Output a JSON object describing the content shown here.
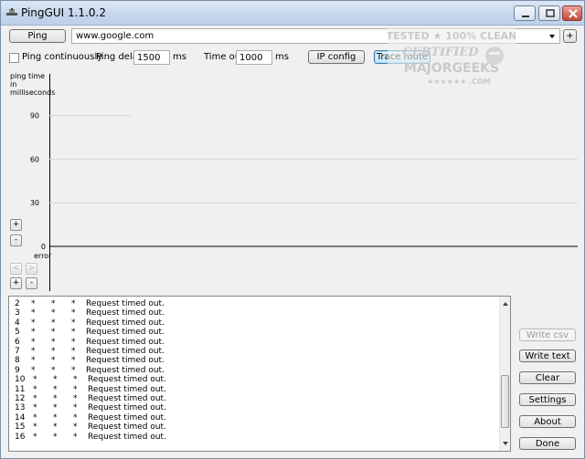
{
  "window": {
    "title": "PingGUI 1.1.0.2"
  },
  "toolbar": {
    "ping_label": "Ping",
    "host_value": "www.google.com",
    "add_label": "+",
    "ping_continuously_label": "Ping continuously",
    "ping_continuously_checked": false,
    "ping_delay_label": "Ping delay",
    "ping_delay_value": "1500",
    "ping_delay_unit": "ms",
    "timeout_label": "Time out",
    "timeout_value": "1000",
    "timeout_unit": "ms",
    "ip_config_label": "IP config",
    "trace_route_label": "Trace route"
  },
  "watermark": {
    "line1": "TESTED ★ 100% CLEAN",
    "line2": "CERTIFIED",
    "line3": "MAJORGEEKS",
    "line4": "★★★★★★ .COM"
  },
  "chart_data": {
    "type": "line",
    "ylabel": "ping time in milliseconds",
    "yticks": [
      90,
      60,
      30,
      0
    ],
    "ylim": [
      0,
      100
    ],
    "error_label": "error",
    "series": [],
    "grid": true
  },
  "chart_controls": {
    "zoom_in_label": "+",
    "zoom_out_label": "-",
    "scroll_left_label": "<",
    "scroll_right_label": ">",
    "x_zoom_in_label": "+",
    "x_zoom_out_label": "-"
  },
  "log": {
    "rows": [
      {
        "n": "2",
        "a": "*",
        "b": "*",
        "c": "*",
        "msg": "Request timed out."
      },
      {
        "n": "3",
        "a": "*",
        "b": "*",
        "c": "*",
        "msg": "Request timed out."
      },
      {
        "n": "4",
        "a": "*",
        "b": "*",
        "c": "*",
        "msg": "Request timed out."
      },
      {
        "n": "5",
        "a": "*",
        "b": "*",
        "c": "*",
        "msg": "Request timed out."
      },
      {
        "n": "6",
        "a": "*",
        "b": "*",
        "c": "*",
        "msg": "Request timed out."
      },
      {
        "n": "7",
        "a": "*",
        "b": "*",
        "c": "*",
        "msg": "Request timed out."
      },
      {
        "n": "8",
        "a": "*",
        "b": "*",
        "c": "*",
        "msg": "Request timed out."
      },
      {
        "n": "9",
        "a": "*",
        "b": "*",
        "c": "*",
        "msg": "Request timed out."
      },
      {
        "n": "10",
        "a": "*",
        "b": "*",
        "c": "*",
        "msg": "Request timed out."
      },
      {
        "n": "11",
        "a": "*",
        "b": "*",
        "c": "*",
        "msg": "Request timed out."
      },
      {
        "n": "12",
        "a": "*",
        "b": "*",
        "c": "*",
        "msg": "Request timed out."
      },
      {
        "n": "13",
        "a": "*",
        "b": "*",
        "c": "*",
        "msg": "Request timed out."
      },
      {
        "n": "14",
        "a": "*",
        "b": "*",
        "c": "*",
        "msg": "Request timed out."
      },
      {
        "n": "15",
        "a": "*",
        "b": "*",
        "c": "*",
        "msg": "Request timed out."
      },
      {
        "n": "16",
        "a": "*",
        "b": "*",
        "c": "*",
        "msg": "Request timed out."
      }
    ]
  },
  "side_buttons": {
    "write_csv": "Write csv",
    "write_text": "Write text",
    "clear": "Clear",
    "settings": "Settings",
    "about": "About",
    "done": "Done"
  },
  "colors": {
    "gridline": "#d7d7d7",
    "axis": "#000000",
    "window_bg": "#f0f0f0"
  }
}
